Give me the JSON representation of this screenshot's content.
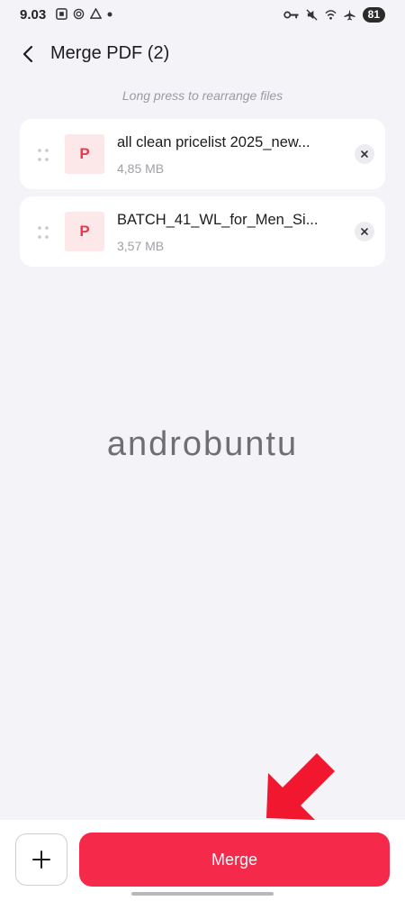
{
  "status_bar": {
    "time": "9.03",
    "battery": "81",
    "icons_left": [
      "screenshot-icon",
      "hotspot-icon",
      "sync-icon",
      "dot-icon"
    ],
    "icons_right": [
      "vpn-key-icon",
      "mute-icon",
      "wifi-icon",
      "airplane-icon",
      "battery-icon"
    ]
  },
  "header": {
    "title": "Merge PDF (2)"
  },
  "hint": "Long press to rearrange files",
  "files": [
    {
      "thumb_letter": "P",
      "name": "all clean pricelist 2025_new...",
      "size": "4,85 MB"
    },
    {
      "thumb_letter": "P",
      "name": "BATCH_41_WL_for_Men_Si...",
      "size": "3,57 MB"
    }
  ],
  "watermark": "androbuntu",
  "bottom": {
    "add_symbol": "+",
    "merge_label": "Merge"
  },
  "colors": {
    "accent": "#f5294a",
    "pdf_icon": "#e8394c",
    "arrow": "#f0172e",
    "background": "#f4f4f8"
  }
}
